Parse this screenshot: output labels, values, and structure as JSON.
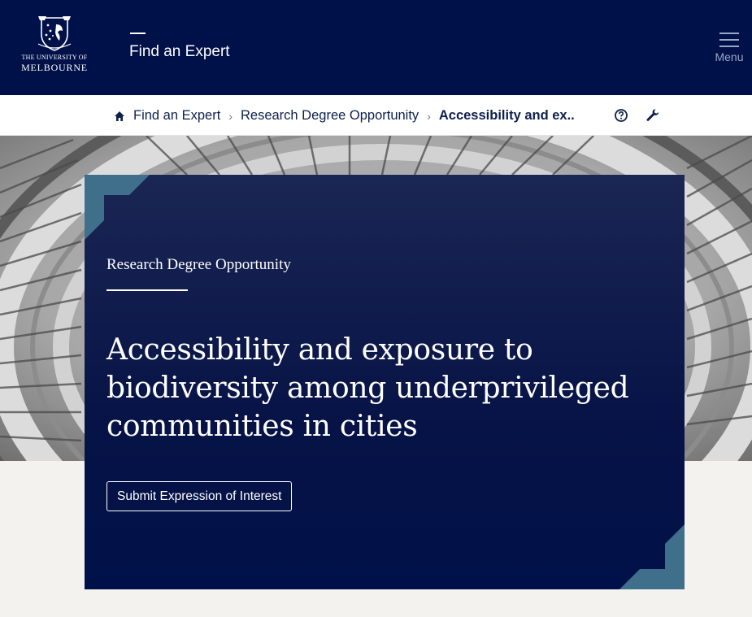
{
  "header": {
    "logo": {
      "line1": "THE UNIVERSITY OF",
      "line2": "MELBOURNE"
    },
    "site_title": "Find an Expert",
    "menu_label": "Menu",
    "menu_icon": "hamburger-icon"
  },
  "breadcrumb": {
    "home_icon": "home-icon",
    "items": [
      "Find an Expert",
      "Research Degree Opportunity"
    ],
    "current": "Accessibility and ex..",
    "help_icon": "help-circle-icon",
    "tools_icon": "wrench-icon"
  },
  "hero": {
    "eyebrow": "Research Degree Opportunity",
    "title": "Accessibility and exposure to biodiversity among underprivileged communities in cities",
    "cta_label": "Submit Expression of Interest",
    "accent_color": "#3f6f8a"
  },
  "colors": {
    "navy": "#001149",
    "page_background": "#f3f2ee"
  }
}
